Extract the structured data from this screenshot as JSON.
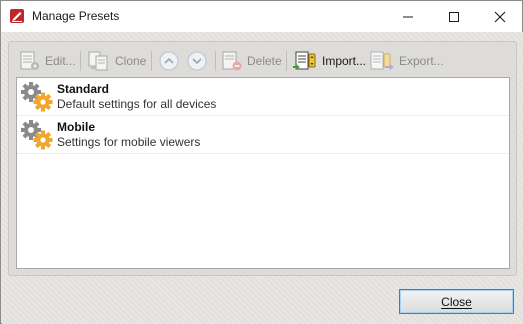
{
  "window": {
    "title": "Manage Presets",
    "icon": "pdf-editor-app-icon",
    "controls": [
      "minimize-icon",
      "maximize-icon",
      "close-icon"
    ]
  },
  "toolbar": {
    "edit_label": "Edit...",
    "clone_label": "Clone",
    "move_up_icon": "chevron-up-icon",
    "move_down_icon": "chevron-down-icon",
    "delete_label": "Delete",
    "import_label": "Import...",
    "export_label": "Export..."
  },
  "presets": [
    {
      "name": "Standard",
      "description": "Default settings for all devices",
      "icon": "gears-icon"
    },
    {
      "name": "Mobile",
      "description": "Settings for mobile viewers",
      "icon": "gears-icon"
    }
  ],
  "footer": {
    "close_label": "Close"
  },
  "colors": {
    "accent_border": "#3c7fb1",
    "gear_gray": "#8a8a8a",
    "gear_orange": "#f2a72c",
    "app_icon_red": "#c0272d"
  }
}
